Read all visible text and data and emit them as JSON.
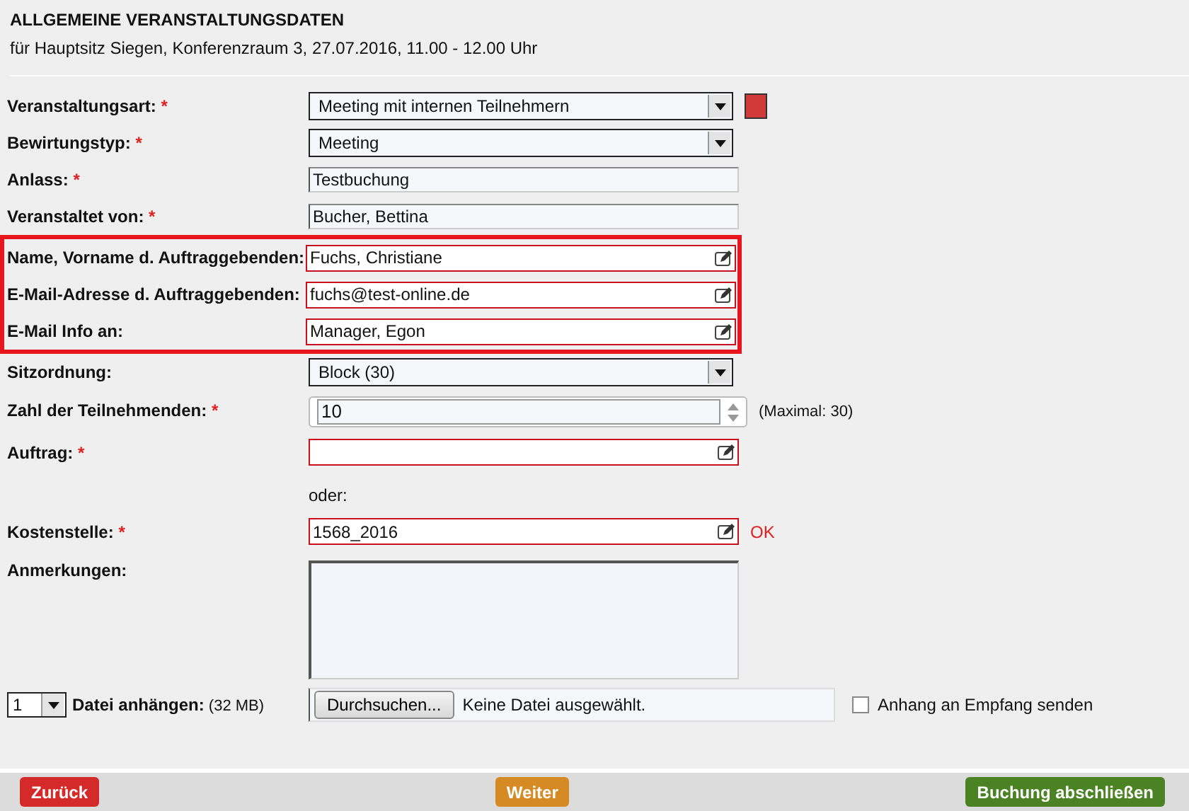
{
  "header": {
    "title": "ALLGEMEINE VERANSTALTUNGSDATEN",
    "subtitle": "für Hauptsitz Siegen, Konferenzraum 3, 27.07.2016, 11.00 - 12.00 Uhr"
  },
  "fields": [
    {
      "kind": "select",
      "label": "Veranstaltungsart:",
      "required_mark": "*",
      "value": "Meeting mit internen Teilnehmern",
      "color": "#d23a3a"
    },
    {
      "kind": "select",
      "label": "Bewirtungstyp:",
      "required_mark": "*",
      "value": "Meeting"
    },
    {
      "kind": "text",
      "label": "Anlass:",
      "required_mark": "*",
      "value": "Testbuchung"
    },
    {
      "kind": "text",
      "label": "Veranstaltet von:",
      "required_mark": "*",
      "value": "Bucher, Bettina"
    },
    {
      "kind": "frame",
      "children": [
        {
          "kind": "edit",
          "label": "Name, Vorname d. Auftraggebenden:",
          "value": "Fuchs, Christiane"
        },
        {
          "kind": "edit",
          "label": "E-Mail-Adresse d. Auftraggebenden:",
          "value": "fuchs@test-online.de"
        },
        {
          "kind": "edit",
          "label": "E-Mail Info an:",
          "value": "Manager, Egon"
        }
      ]
    },
    {
      "kind": "select",
      "label": "Sitzordnung:",
      "value": "Block (30)"
    },
    {
      "kind": "spin",
      "label": "Zahl der Teilnehmenden:",
      "required_mark": "*",
      "value": "10",
      "note": "(Maximal: 30)"
    },
    {
      "kind": "edit",
      "label": "Auftrag:",
      "required_mark": "*"
    },
    {
      "kind": "hint",
      "text": "oder:"
    },
    {
      "kind": "edit",
      "label": "Kostenstelle:",
      "required_mark": "*",
      "value": "1568_2016",
      "status": "OK"
    },
    {
      "kind": "textarea",
      "label": "Anmerkungen:"
    }
  ],
  "attachment": {
    "count": "1",
    "label": "**Datei anhängen:** (32 MB)",
    "browse_button": "Durchsuchen...",
    "file_status": "Keine Datei ausgewählt.",
    "checkbox_label": "Anhang an Empfang senden",
    "checked": false
  },
  "footer": [
    {
      "kind": "back",
      "label": "Zurück"
    },
    {
      "kind": "next",
      "label": "Weiter"
    },
    {
      "kind": "finish",
      "label": "Buchung abschließen"
    }
  ]
}
